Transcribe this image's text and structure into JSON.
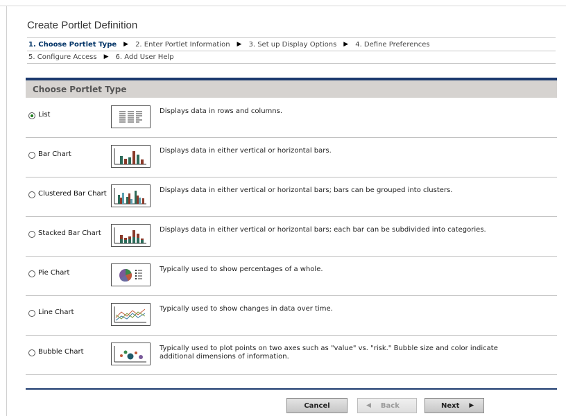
{
  "page": {
    "title": "Create Portlet Definition"
  },
  "wizard": {
    "steps_row1": [
      {
        "label": "1. Choose Portlet Type",
        "active": true
      },
      {
        "label": "2. Enter Portlet Information",
        "active": false
      },
      {
        "label": "3. Set up Display Options",
        "active": false
      },
      {
        "label": "4. Define Preferences",
        "active": false
      }
    ],
    "steps_row2": [
      {
        "label": "5. Configure Access",
        "active": false
      },
      {
        "label": "6. Add User Help",
        "active": false
      }
    ],
    "separator_icon": "right-triangle-arrow-icon"
  },
  "section": {
    "header": "Choose Portlet Type"
  },
  "options": [
    {
      "label": "List",
      "selected": true,
      "icon": "list-thumbnail-icon",
      "description": "Displays data in rows and columns."
    },
    {
      "label": "Bar Chart",
      "selected": false,
      "icon": "bar-chart-thumbnail-icon",
      "description": "Displays data in either vertical or horizontal bars."
    },
    {
      "label": "Clustered Bar Chart",
      "selected": false,
      "icon": "clustered-bar-chart-thumbnail-icon",
      "description": "Displays data in either vertical or horizontal bars; bars can be grouped into clusters."
    },
    {
      "label": "Stacked Bar Chart",
      "selected": false,
      "icon": "stacked-bar-chart-thumbnail-icon",
      "description": "Displays data in either vertical or horizontal bars; each bar can be subdivided into categories."
    },
    {
      "label": "Pie Chart",
      "selected": false,
      "icon": "pie-chart-thumbnail-icon",
      "description": "Typically used to show percentages of a whole."
    },
    {
      "label": "Line Chart",
      "selected": false,
      "icon": "line-chart-thumbnail-icon",
      "description": "Typically used to show changes in data over time."
    },
    {
      "label": "Bubble Chart",
      "selected": false,
      "icon": "bubble-chart-thumbnail-icon",
      "description": "Typically used to plot points on two axes such as \"value\" vs. \"risk.\" Bubble size and color indicate additional dimensions of information."
    }
  ],
  "buttons": {
    "cancel": "Cancel",
    "back": "Back",
    "next": "Next"
  },
  "colors": {
    "accent_bar": "#1c3a6e",
    "section_header_bg": "#d6d3d0",
    "active_step": "#003366",
    "radio_selected": "#1a7a1a"
  }
}
